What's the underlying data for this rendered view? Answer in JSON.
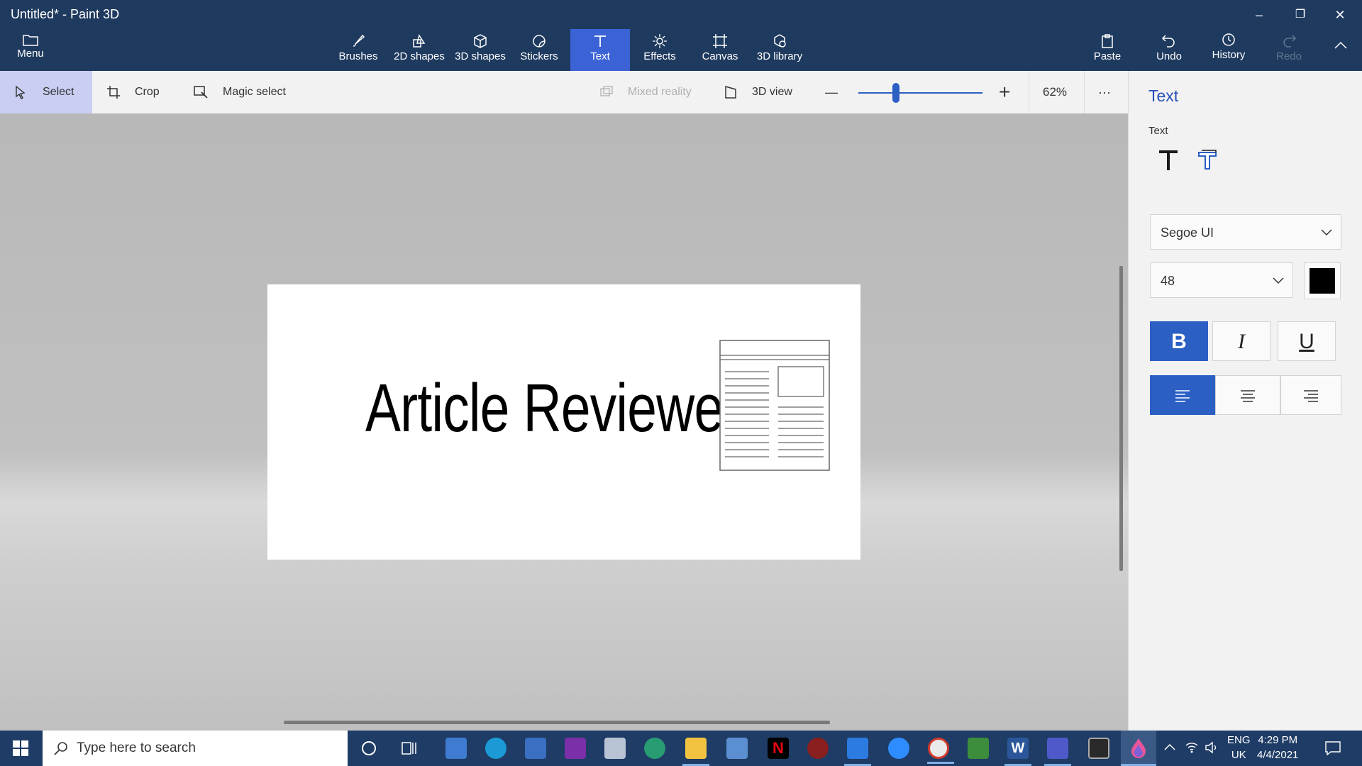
{
  "window": {
    "title": "Untitled* - Paint 3D",
    "minimize": "–",
    "restore": "❐",
    "close": "✕"
  },
  "toolbar": {
    "menu": "Menu",
    "tools": [
      {
        "label": "Brushes"
      },
      {
        "label": "2D shapes"
      },
      {
        "label": "3D shapes"
      },
      {
        "label": "Stickers"
      },
      {
        "label": "Text"
      },
      {
        "label": "Effects"
      },
      {
        "label": "Canvas"
      },
      {
        "label": "3D library"
      }
    ],
    "paste": "Paste",
    "undo": "Undo",
    "history": "History",
    "redo": "Redo",
    "active_tool": "Text",
    "accent": "#3c63d6"
  },
  "commandbar": {
    "select": "Select",
    "crop": "Crop",
    "magic_select": "Magic select",
    "mixed_reality": "Mixed reality",
    "view_3d": "3D view",
    "zoom_minus": "—",
    "zoom_plus": "+",
    "zoom_level": "62%",
    "zoom_fraction": 0.3,
    "more": "···"
  },
  "canvas": {
    "text": "Article Reviewer",
    "sticker": "newspaper-icon"
  },
  "panel": {
    "title": "Text",
    "section": "Text",
    "font": "Segoe UI",
    "size": "48",
    "color": "#000000",
    "bold": "B",
    "italic": "I",
    "underline": "U",
    "bold_on": true,
    "align": "left"
  },
  "taskbar": {
    "search_placeholder": "Type here to search",
    "lang_line1": "ENG",
    "lang_line2": "UK",
    "time": "4:29 PM",
    "date": "4/4/2021"
  }
}
